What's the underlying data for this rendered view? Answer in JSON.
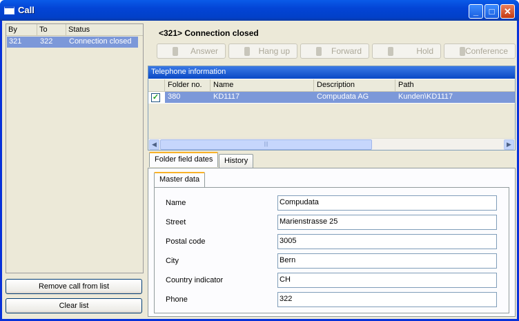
{
  "window": {
    "title": "Call"
  },
  "calls": {
    "columns": [
      "By",
      "To",
      "Status"
    ],
    "rows": [
      {
        "by": "321",
        "to": "322",
        "status": "Connection closed"
      }
    ],
    "remove_label": "Remove call from list",
    "clear_label": "Clear list"
  },
  "status_title": "<321> Connection closed",
  "toolbar": {
    "answer": "Answer",
    "hangup": "Hang up",
    "forward": "Forward",
    "hold": "Hold",
    "conference": "Conference"
  },
  "info": {
    "caption": "Telephone information",
    "columns": [
      "Folder no.",
      "Name",
      "Description",
      "Path"
    ],
    "rows": [
      {
        "checked": true,
        "folder": "380",
        "name": "KD1117",
        "description": "Compudata AG",
        "path": "Kunden\\KD1117"
      }
    ]
  },
  "tabs": [
    "Folder field dates",
    "History"
  ],
  "subtab": "Master data",
  "fields": [
    {
      "label": "Name",
      "value": "Compudata"
    },
    {
      "label": "Street",
      "value": "Marienstrasse 25"
    },
    {
      "label": "Postal code",
      "value": "3005"
    },
    {
      "label": "City",
      "value": "Bern"
    },
    {
      "label": "Country indicator",
      "value": "CH"
    },
    {
      "label": "Phone",
      "value": "322"
    }
  ],
  "colors": {
    "titlebar": "#0344d6",
    "selection": "#7c98d9",
    "tab_highlight": "#f8b228"
  }
}
